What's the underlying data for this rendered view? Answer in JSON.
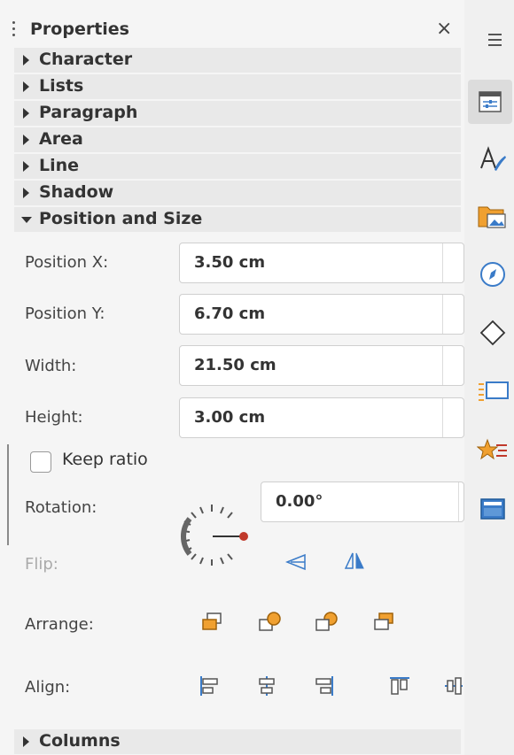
{
  "panel": {
    "title": "Properties",
    "close_symbol": "×"
  },
  "sections": [
    {
      "label": "Character",
      "expanded": false
    },
    {
      "label": "Lists",
      "expanded": false
    },
    {
      "label": "Paragraph",
      "expanded": false
    },
    {
      "label": "Area",
      "expanded": false
    },
    {
      "label": "Line",
      "expanded": false
    },
    {
      "label": "Shadow",
      "expanded": false
    },
    {
      "label": "Position and Size",
      "expanded": true
    },
    {
      "label": "Columns",
      "expanded": false
    }
  ],
  "position_size": {
    "position_x": {
      "label": "Position X:",
      "value": "3.50 cm"
    },
    "position_y": {
      "label": "Position Y:",
      "value": "6.70 cm"
    },
    "width": {
      "label": "Width:",
      "value": "21.50 cm"
    },
    "height": {
      "label": "Height:",
      "value": "3.00 cm"
    },
    "keep_ratio": {
      "label": "Keep ratio",
      "checked": false
    },
    "rotation": {
      "label": "Rotation:",
      "value": "0.00°"
    },
    "flip_label": "Flip:",
    "arrange_label": "Arrange:",
    "align_label": "Align:"
  },
  "colors": {
    "accent_orange": "#f0a030",
    "accent_blue": "#3a7bc8",
    "dial_red": "#c0392b"
  },
  "deck_icons": [
    "menu-icon",
    "properties-icon",
    "styles-icon",
    "gallery-icon",
    "navigator-icon",
    "shapes-icon",
    "page-icon",
    "animation-icon",
    "design-icon"
  ]
}
